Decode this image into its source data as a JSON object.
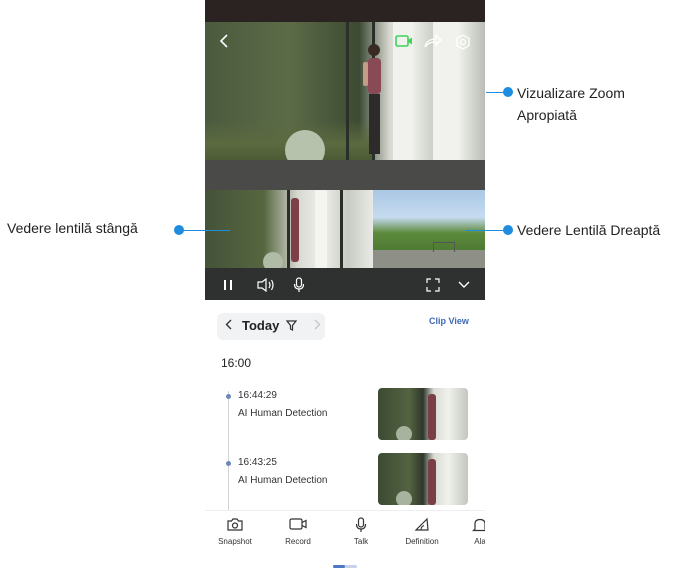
{
  "annotations": {
    "zoom_line1": "Vizualizare Zoom",
    "zoom_line2": "Apropiată",
    "left_lens": "Vedere lentilă stângă",
    "right_lens": "Vedere Lentilă Dreaptă",
    "accent_color": "#1e8de0"
  },
  "video": {
    "top_icons": [
      "back-icon",
      "recording-icon",
      "share-icon",
      "settings-icon"
    ],
    "controls": [
      "pause-icon",
      "volume-icon",
      "microphone-icon",
      "fullscreen-icon",
      "chevron-down-icon"
    ]
  },
  "timeline": {
    "date_label": "Today",
    "clip_view_label": "Clip View",
    "hour_header": "16:00",
    "events": [
      {
        "time": "16:44:29",
        "title": "AI Human Detection"
      },
      {
        "time": "16:43:25",
        "title": "AI Human Detection"
      }
    ]
  },
  "actions": [
    {
      "label": "Snapshot",
      "icon": "camera-icon"
    },
    {
      "label": "Record",
      "icon": "video-record-icon"
    },
    {
      "label": "Talk",
      "icon": "microphone-icon"
    },
    {
      "label": "Definition",
      "icon": "definition-icon"
    },
    {
      "label": "Ala",
      "icon": "alarm-icon"
    }
  ]
}
